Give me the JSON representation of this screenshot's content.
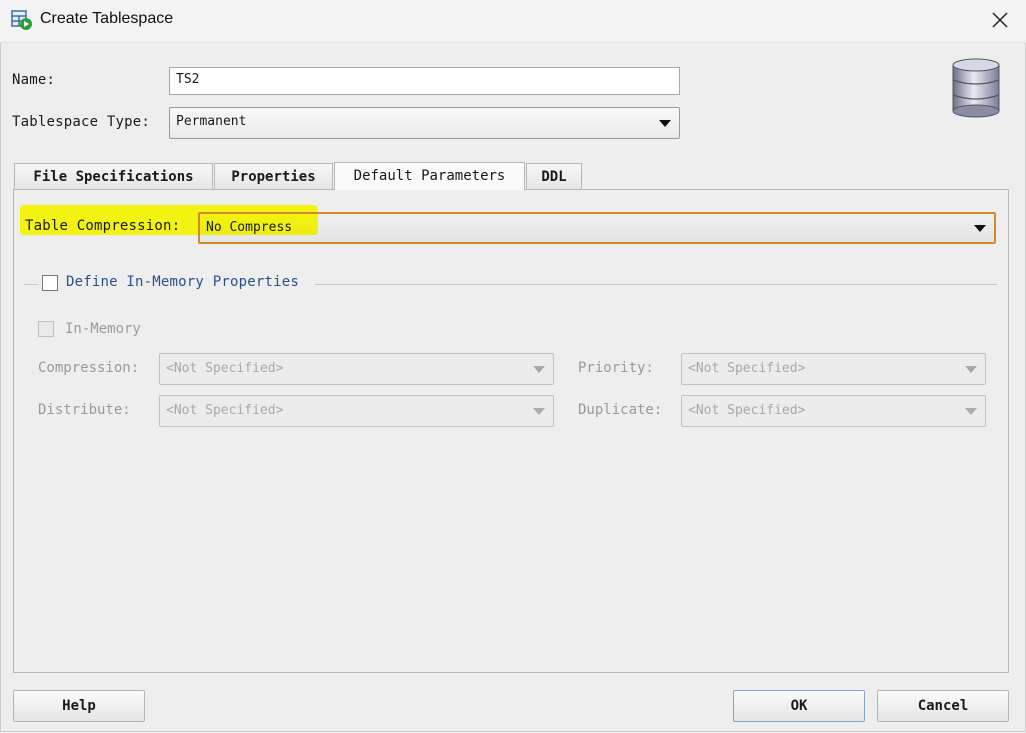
{
  "window": {
    "title": "Create Tablespace",
    "close_label": "✕"
  },
  "form": {
    "name_label": "Name:",
    "name_value": "TS2",
    "type_label": "Tablespace Type:",
    "type_value": "Permanent"
  },
  "tabs": [
    {
      "label": "File Specifications",
      "active": false
    },
    {
      "label": "Properties",
      "active": false
    },
    {
      "label": "Default Parameters",
      "active": true
    },
    {
      "label": "DDL",
      "active": false
    }
  ],
  "default_parameters": {
    "table_compression_label": "Table Compression:",
    "table_compression_value": "No Compress",
    "define_in_memory_label": "Define In-Memory Properties",
    "in_memory_label": "In-Memory",
    "compression_label": "Compression:",
    "compression_value": "<Not Specified>",
    "priority_label": "Priority:",
    "priority_value": "<Not Specified>",
    "distribute_label": "Distribute:",
    "distribute_value": "<Not Specified>",
    "duplicate_label": "Duplicate:",
    "duplicate_value": "<Not Specified>"
  },
  "buttons": {
    "help": "Help",
    "ok": "OK",
    "cancel": "Cancel"
  },
  "colors": {
    "highlight": "#f2f205",
    "link_text": "#2b4f8a",
    "focus_border": "#d08a2a"
  },
  "icons": {
    "app": "tablespace-app-icon",
    "database": "database-cylinder-icon",
    "close": "close-icon"
  }
}
